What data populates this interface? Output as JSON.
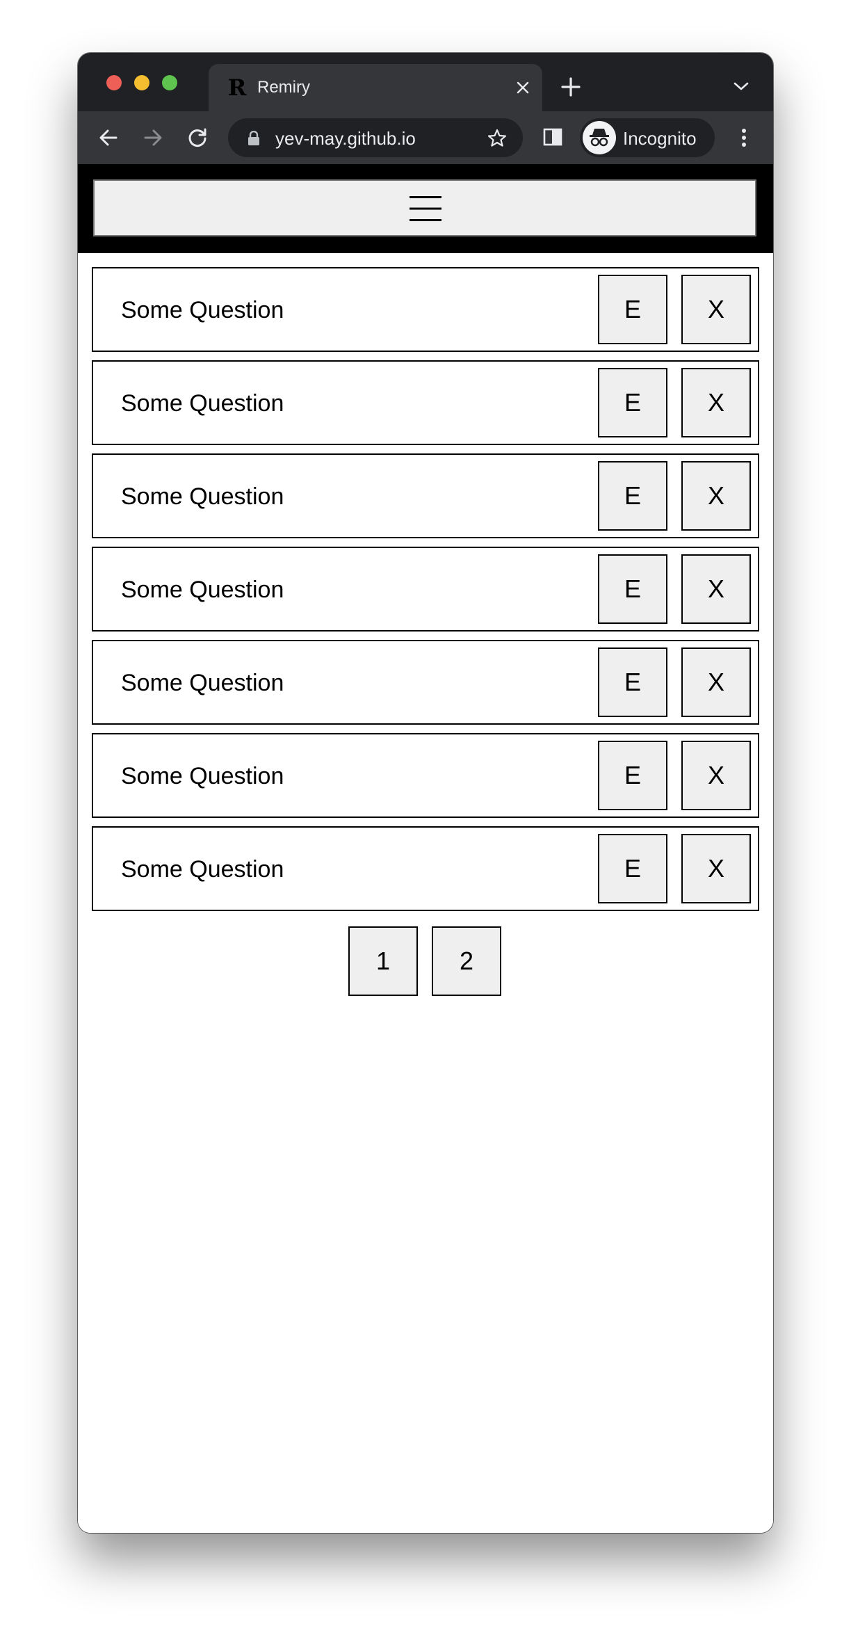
{
  "browser": {
    "tab_title": "Remiry",
    "favicon_letter": "R",
    "url": "yev-may.github.io",
    "profile_label": "Incognito",
    "icons": [
      "close-icon",
      "plus-icon",
      "chevron-down-icon",
      "back-arrow-icon",
      "forward-arrow-icon",
      "reload-icon",
      "lock-icon",
      "star-icon",
      "side-panel-icon",
      "incognito-icon",
      "more-vert-icon"
    ]
  },
  "header": {
    "menu_icon": "hamburger-menu-icon"
  },
  "questions": [
    {
      "text": "Some Question",
      "edit_label": "E",
      "delete_label": "X"
    },
    {
      "text": "Some Question",
      "edit_label": "E",
      "delete_label": "X"
    },
    {
      "text": "Some Question",
      "edit_label": "E",
      "delete_label": "X"
    },
    {
      "text": "Some Question",
      "edit_label": "E",
      "delete_label": "X"
    },
    {
      "text": "Some Question",
      "edit_label": "E",
      "delete_label": "X"
    },
    {
      "text": "Some Question",
      "edit_label": "E",
      "delete_label": "X"
    },
    {
      "text": "Some Question",
      "edit_label": "E",
      "delete_label": "X"
    }
  ],
  "pagination": {
    "pages": [
      "1",
      "2"
    ]
  },
  "colors": {
    "tabstrip": "#202124",
    "toolbar": "#35363a",
    "header_bar": "#000000",
    "button_bg": "#efefef",
    "close_dot": "#ee5f57",
    "minimize_dot": "#f5bd30",
    "maximize_dot": "#5ec44f"
  }
}
